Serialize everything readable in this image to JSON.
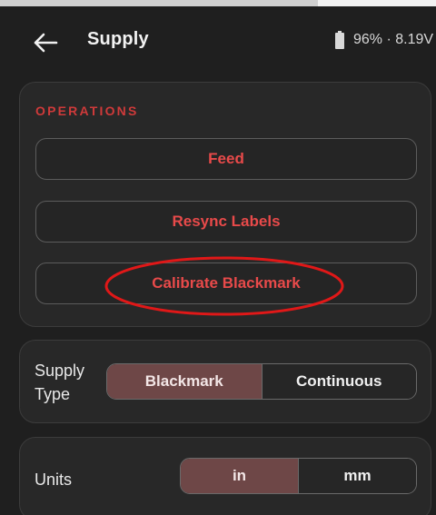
{
  "header": {
    "title": "Supply",
    "battery": "96% · 8.19V"
  },
  "operations": {
    "section_title": "OPERATIONS",
    "buttons": {
      "feed": "Feed",
      "resync": "Resync Labels",
      "calibrate": "Calibrate Blackmark"
    }
  },
  "supply_type": {
    "label": "Supply Type",
    "options": [
      "Blackmark",
      "Continuous"
    ],
    "selected": "Blackmark"
  },
  "units": {
    "label": "Units",
    "options": [
      "in",
      "mm"
    ],
    "selected": "in"
  },
  "colors": {
    "accent": "#e84a4a",
    "selected_segment": "#6e4747",
    "background": "#1f1f1f",
    "card": "#282828",
    "annotation": "#e01818"
  },
  "icons": {
    "back": "arrow-left-icon",
    "battery": "battery-icon"
  }
}
